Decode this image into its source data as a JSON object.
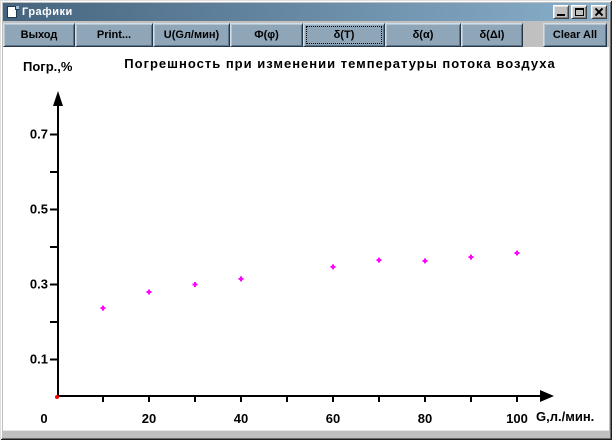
{
  "window": {
    "title": "Графики",
    "controls": [
      {
        "name": "minimize"
      },
      {
        "name": "maximize"
      },
      {
        "name": "close"
      }
    ]
  },
  "toolbar": {
    "buttons": [
      {
        "name": "exit",
        "label": "Выход"
      },
      {
        "name": "print",
        "label": "Print..."
      },
      {
        "name": "u-g-flow",
        "label": "U(Gл/мин)"
      },
      {
        "name": "phi",
        "label": "Ф(φ)"
      },
      {
        "name": "delta-t",
        "label": "δ(T)",
        "focused": true
      },
      {
        "name": "delta-alpha",
        "label": "δ(α)"
      },
      {
        "name": "delta-di",
        "label": "δ(ΔI)"
      },
      {
        "name": "clear-all",
        "label": "Clear All",
        "separated": true
      }
    ]
  },
  "chart_data": {
    "type": "scatter",
    "title": "Погрешность при изменении температуры потока воздуха",
    "xlabel": "G,л./мин.",
    "ylabel": "Погр.,%",
    "x": [
      10,
      20,
      30,
      40,
      60,
      70,
      80,
      90,
      100
    ],
    "y": [
      0.237,
      0.28,
      0.3,
      0.315,
      0.347,
      0.365,
      0.363,
      0.373,
      0.384
    ],
    "xlim": [
      0,
      110
    ],
    "ylim": [
      0,
      0.8
    ],
    "x_ticks": [
      10,
      20,
      30,
      40,
      50,
      60,
      70,
      80,
      90,
      100
    ],
    "x_tick_labels": [
      0,
      20,
      40,
      60,
      80,
      100
    ],
    "y_ticks": [
      0.1,
      0.2,
      0.3,
      0.4,
      0.5,
      0.6,
      0.7
    ],
    "y_tick_labels": [
      0.1,
      0.3,
      0.5,
      0.7
    ],
    "grid": false,
    "legend": "none",
    "marker": "plus",
    "point_color": "#ff00ff",
    "origin_marker_color": "#ff0000",
    "axis_color": "#000000"
  }
}
